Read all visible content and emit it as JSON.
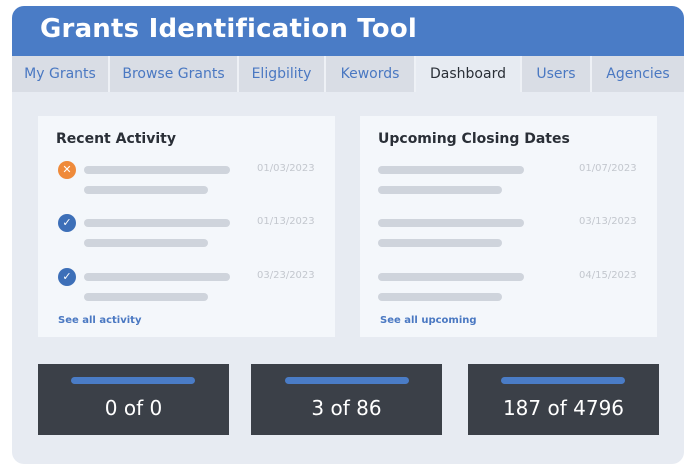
{
  "app": {
    "title": "Grants Identification Tool"
  },
  "tabs": [
    {
      "label": "My Grants"
    },
    {
      "label": "Browse Grants"
    },
    {
      "label": "Eligbility"
    },
    {
      "label": "Kewords"
    },
    {
      "label": "Dashboard",
      "active": true
    },
    {
      "label": "Users"
    },
    {
      "label": "Agencies"
    }
  ],
  "recent_activity": {
    "title": "Recent Activity",
    "items": [
      {
        "status_icon": "close-icon",
        "date": "01/03/2023"
      },
      {
        "status_icon": "check-icon",
        "date": "01/13/2023"
      },
      {
        "status_icon": "check-icon",
        "date": "03/23/2023"
      }
    ],
    "see_all": "See all activity"
  },
  "upcoming_closing": {
    "title": "Upcoming Closing Dates",
    "items": [
      {
        "date": "01/07/2023"
      },
      {
        "date": "03/13/2023"
      },
      {
        "date": "04/15/2023"
      }
    ],
    "see_all": "See all upcoming"
  },
  "stats": [
    {
      "value": "0 of 0"
    },
    {
      "value": "3 of 86"
    },
    {
      "value": "187 of 4796"
    }
  ],
  "colors": {
    "brand": "#4a7cc6",
    "link": "#4a78c2",
    "warning": "#ef8a3a",
    "success": "#3d6fb8",
    "stat_background": "#3b4048"
  }
}
